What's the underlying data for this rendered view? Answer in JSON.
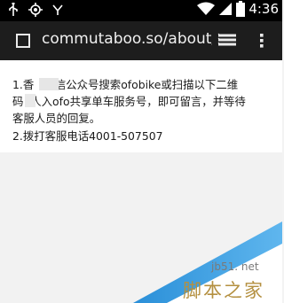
{
  "status_bar": {
    "time": "4:36",
    "icons": [
      "wifi-icon",
      "signal-icon",
      "battery-icon"
    ],
    "left_icons": [
      "usb-icon",
      "gps-icon",
      "notification-icon"
    ]
  },
  "browser": {
    "url": "commutaboo.so/about/he",
    "tab_icon": "tab-square-icon",
    "bookmark_icon": "books-icon",
    "menu_icon": "overflow-menu-icon"
  },
  "content": {
    "text": "1.香      信公众号搜索ofobike或扫描以下二维\n码  人入ofo共享单车服务号，即可留言，并等待\n客服人员的回复。\n2.拨打客服电话4001-507507"
  },
  "watermark": {
    "site": "jb51. net",
    "name": "脚本之家"
  },
  "colors": {
    "status_bar": "#000000",
    "address_bar": "#1d1d1d",
    "content_bg": "#ffffff",
    "page_bg": "#f2f2f2",
    "watermark_blue": "#2a8fd8"
  }
}
